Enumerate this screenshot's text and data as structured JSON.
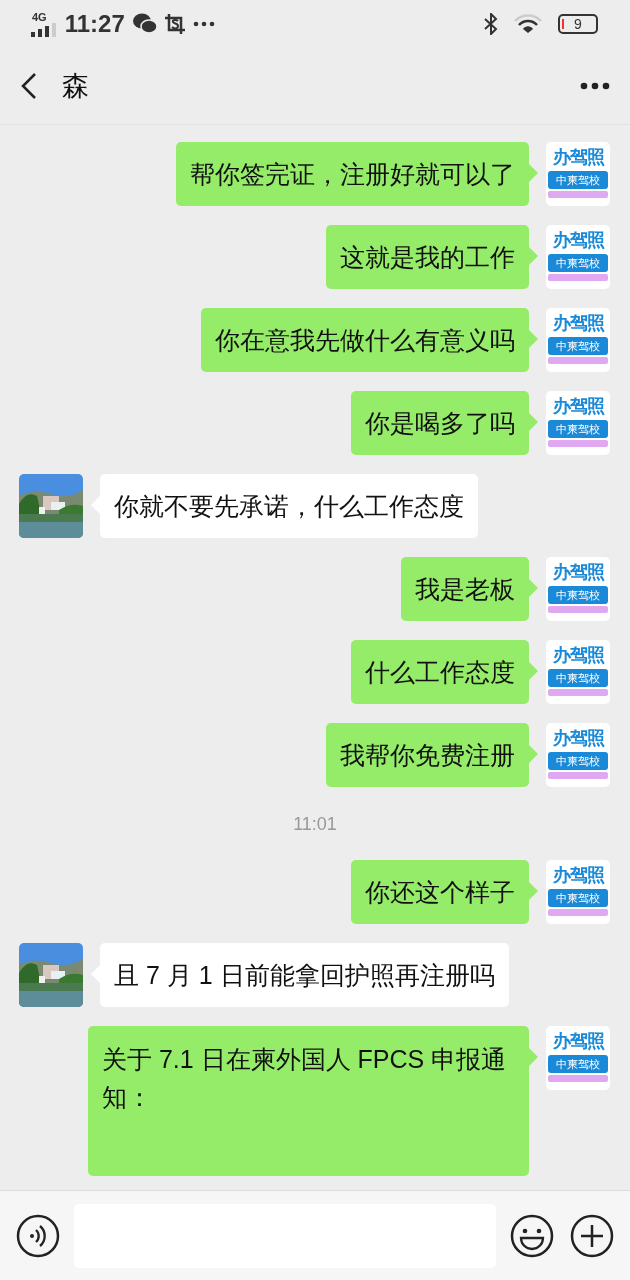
{
  "status_bar": {
    "network": "4G",
    "time": "11:27",
    "battery": "9"
  },
  "header": {
    "title": "森"
  },
  "messages": [
    {
      "kind": "out",
      "text": "帮你签完证，注册好就可以了",
      "avatar": {
        "line1": "办驾照",
        "line2": "中柬驾校"
      }
    },
    {
      "kind": "out",
      "text": "这就是我的工作",
      "avatar": {
        "line1": "办驾照",
        "line2": "中柬驾校"
      }
    },
    {
      "kind": "out",
      "text": "你在意我先做什么有意义吗",
      "avatar": {
        "line1": "办驾照",
        "line2": "中柬驾校"
      }
    },
    {
      "kind": "out",
      "text": "你是喝多了吗",
      "avatar": {
        "line1": "办驾照",
        "line2": "中柬驾校"
      }
    },
    {
      "kind": "in",
      "text": "你就不要先承诺，什么工作态度"
    },
    {
      "kind": "out",
      "text": "我是老板",
      "avatar": {
        "line1": "办驾照",
        "line2": "中柬驾校"
      }
    },
    {
      "kind": "out",
      "text": "什么工作态度",
      "avatar": {
        "line1": "办驾照",
        "line2": "中柬驾校"
      }
    },
    {
      "kind": "out",
      "text": "我帮你免费注册",
      "avatar": {
        "line1": "办驾照",
        "line2": "中柬驾校"
      }
    },
    {
      "kind": "time",
      "text": "11:01"
    },
    {
      "kind": "out",
      "text": "你还这个样子",
      "avatar": {
        "line1": "办驾照",
        "line2": "中柬驾校"
      }
    },
    {
      "kind": "in",
      "text": "且 7 月 1 日前能拿回护照再注册吗"
    },
    {
      "kind": "out",
      "text": "关于 7.1 日在柬外国人 FPCS 申报通知：",
      "avatar": {
        "line1": "办驾照",
        "line2": "中柬驾校"
      },
      "cut": true
    }
  ]
}
